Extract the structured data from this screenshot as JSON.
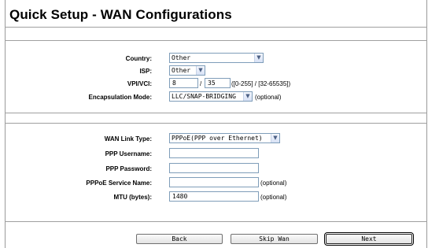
{
  "page": {
    "title": "Quick Setup - WAN Configurations"
  },
  "section1": {
    "country": {
      "label": "Country:",
      "value": "Other"
    },
    "isp": {
      "label": "ISP:",
      "value": "Other"
    },
    "vpivci": {
      "label": "VPI/VCI:",
      "vpi": "8",
      "separator": "/",
      "vci": "35",
      "hint": "([0-255] / [32-65535])"
    },
    "encapsulation": {
      "label": "Encapsulation Mode:",
      "value": "LLC/SNAP-BRIDGING",
      "hint": "(optional)"
    }
  },
  "section2": {
    "wan_link_type": {
      "label": "WAN Link Type:",
      "value": "PPPoE(PPP over Ethernet)"
    },
    "ppp_username": {
      "label": "PPP Username:",
      "value": ""
    },
    "ppp_password": {
      "label": "PPP Password:",
      "value": ""
    },
    "pppoe_service": {
      "label": "PPPoE Service Name:",
      "value": "",
      "hint": "(optional)"
    },
    "mtu": {
      "label": "MTU (bytes):",
      "value": "1480",
      "hint": "(optional)"
    }
  },
  "buttons": {
    "back": "Back",
    "skip": "Skip Wan",
    "next": "Next"
  },
  "icons": {
    "dropdown": "chevron-down-icon"
  }
}
